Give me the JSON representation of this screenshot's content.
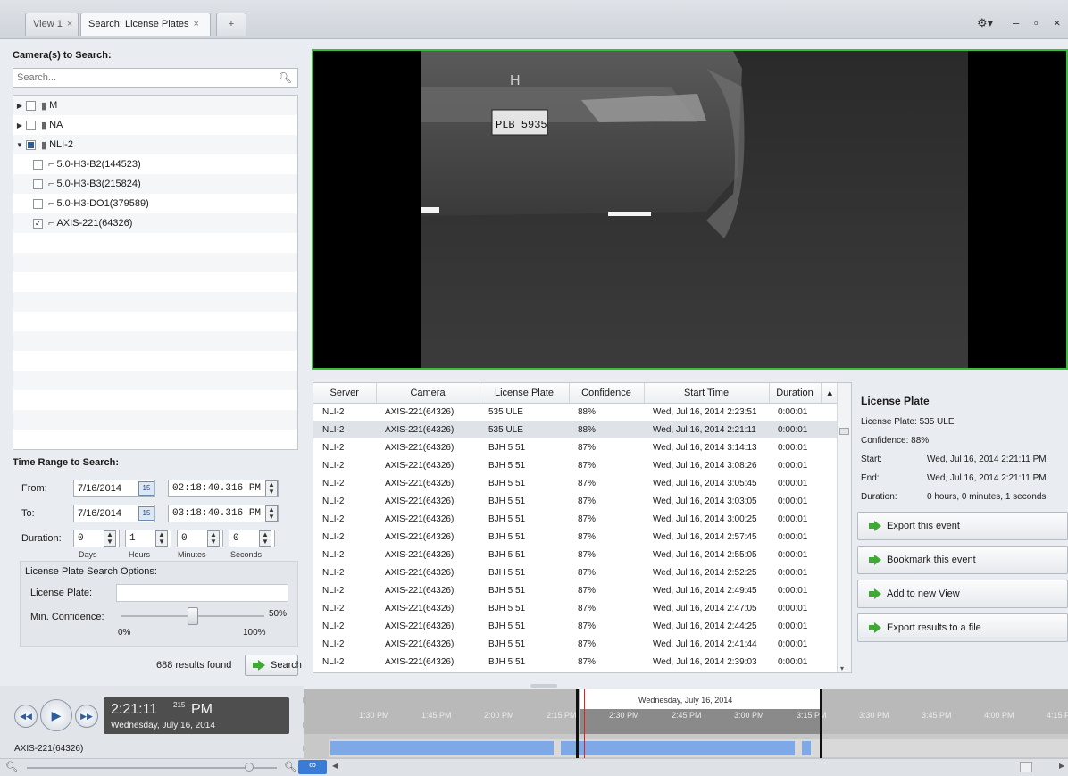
{
  "tabs": [
    {
      "label": "View 1",
      "close": "×",
      "active": false
    },
    {
      "label": "Search: License Plates",
      "close": "×",
      "active": true
    }
  ],
  "new_tab_label": "+",
  "window_controls": {
    "settings": "⚙▾",
    "minimize": "–",
    "restore": "▫",
    "close": "×"
  },
  "left": {
    "cameras_title": "Camera(s) to Search:",
    "search_placeholder": "Search...",
    "tree": [
      {
        "label": "M",
        "level": 0,
        "expanded": false,
        "state": "unchecked",
        "icon": "server-icon"
      },
      {
        "label": "NA",
        "level": 0,
        "expanded": false,
        "state": "unchecked",
        "icon": "server-icon"
      },
      {
        "label": "NLI-2",
        "level": 0,
        "expanded": true,
        "state": "partial",
        "icon": "server-icon"
      },
      {
        "label": "5.0-H3-B2(144523)",
        "level": 1,
        "state": "unchecked",
        "icon": "camera-icon"
      },
      {
        "label": "5.0-H3-B3(215824)",
        "level": 1,
        "state": "unchecked",
        "icon": "camera-icon"
      },
      {
        "label": "5.0-H3-DO1(379589)",
        "level": 1,
        "state": "unchecked",
        "icon": "camera-icon"
      },
      {
        "label": "AXIS-221(64326)",
        "level": 1,
        "state": "checked",
        "icon": "camera-icon"
      }
    ],
    "time_title": "Time Range to Search:",
    "from_label": "From:",
    "from_date": "7/16/2014",
    "from_time": "02:18:40.316 PM",
    "to_label": "To:",
    "to_date": "7/16/2014",
    "to_time": "03:18:40.316 PM",
    "duration_label": "Duration:",
    "duration": {
      "days": "0",
      "hours": "1",
      "minutes": "0",
      "seconds": "0"
    },
    "duration_units": {
      "days": "Days",
      "hours": "Hours",
      "minutes": "Minutes",
      "seconds": "Seconds"
    },
    "calendar_glyph": "15",
    "lp_options_title": "License Plate Search Options:",
    "license_plate_label": "License Plate:",
    "license_plate_value": "",
    "min_conf_label": "Min. Confidence:",
    "min_conf_value": "50%",
    "min_conf_fraction": 0.5,
    "min_conf_min": "0%",
    "min_conf_max": "100%",
    "results_found": "688 results found",
    "search_button": "Search"
  },
  "video": {
    "plate_text": "PLB 5935"
  },
  "table": {
    "columns": [
      "Server",
      "Camera",
      "License Plate",
      "Confidence",
      "Start Time",
      "Duration"
    ],
    "rows": [
      [
        "NLI-2",
        "AXIS-221(64326)",
        "535 ULE",
        "88%",
        "Wed, Jul 16, 2014 2:23:51",
        "0:00:01"
      ],
      [
        "NLI-2",
        "AXIS-221(64326)",
        "535 ULE",
        "88%",
        "Wed, Jul 16, 2014 2:21:11",
        "0:00:01"
      ],
      [
        "NLI-2",
        "AXIS-221(64326)",
        "BJH 5 51",
        "87%",
        "Wed, Jul 16, 2014 3:14:13",
        "0:00:01"
      ],
      [
        "NLI-2",
        "AXIS-221(64326)",
        "BJH 5 51",
        "87%",
        "Wed, Jul 16, 2014 3:08:26",
        "0:00:01"
      ],
      [
        "NLI-2",
        "AXIS-221(64326)",
        "BJH 5 51",
        "87%",
        "Wed, Jul 16, 2014 3:05:45",
        "0:00:01"
      ],
      [
        "NLI-2",
        "AXIS-221(64326)",
        "BJH 5 51",
        "87%",
        "Wed, Jul 16, 2014 3:03:05",
        "0:00:01"
      ],
      [
        "NLI-2",
        "AXIS-221(64326)",
        "BJH 5 51",
        "87%",
        "Wed, Jul 16, 2014 3:00:25",
        "0:00:01"
      ],
      [
        "NLI-2",
        "AXIS-221(64326)",
        "BJH 5 51",
        "87%",
        "Wed, Jul 16, 2014 2:57:45",
        "0:00:01"
      ],
      [
        "NLI-2",
        "AXIS-221(64326)",
        "BJH 5 51",
        "87%",
        "Wed, Jul 16, 2014 2:55:05",
        "0:00:01"
      ],
      [
        "NLI-2",
        "AXIS-221(64326)",
        "BJH 5 51",
        "87%",
        "Wed, Jul 16, 2014 2:52:25",
        "0:00:01"
      ],
      [
        "NLI-2",
        "AXIS-221(64326)",
        "BJH 5 51",
        "87%",
        "Wed, Jul 16, 2014 2:49:45",
        "0:00:01"
      ],
      [
        "NLI-2",
        "AXIS-221(64326)",
        "BJH 5 51",
        "87%",
        "Wed, Jul 16, 2014 2:47:05",
        "0:00:01"
      ],
      [
        "NLI-2",
        "AXIS-221(64326)",
        "BJH 5 51",
        "87%",
        "Wed, Jul 16, 2014 2:44:25",
        "0:00:01"
      ],
      [
        "NLI-2",
        "AXIS-221(64326)",
        "BJH 5 51",
        "87%",
        "Wed, Jul 16, 2014 2:41:44",
        "0:00:01"
      ],
      [
        "NLI-2",
        "AXIS-221(64326)",
        "BJH 5 51",
        "87%",
        "Wed, Jul 16, 2014 2:39:03",
        "0:00:01"
      ]
    ],
    "selected_row": 1
  },
  "details": {
    "title": "License Plate",
    "plate_line": "License Plate: 535 ULE",
    "confidence_line": "Confidence:  88%",
    "start_label": "Start:",
    "start_value": "Wed, Jul 16, 2014 2:21:11 PM",
    "end_label": "End:",
    "end_value": "Wed, Jul 16, 2014 2:21:11 PM",
    "duration_label": "Duration:",
    "duration_value": "0 hours, 0 minutes, 1 seconds",
    "actions": [
      "Export this event",
      "Bookmark this event",
      "Add to new View",
      "Export results to a file"
    ]
  },
  "playback": {
    "time": "2:21:11",
    "ms": "215",
    "ampm": "PM",
    "date": "Wednesday, July 16, 2014",
    "camera": "AXIS-221(64326)",
    "timeline_date": "Wednesday, July 16, 2014",
    "ticks": [
      "1:30 PM",
      "1:45 PM",
      "2:00 PM",
      "2:15 PM",
      "2:30 PM",
      "2:45 PM",
      "3:00 PM",
      "3:15 PM",
      "3:30 PM",
      "3:45 PM",
      "4:00 PM",
      "4:15 PM"
    ],
    "link_label": "∞"
  },
  "colors": {
    "accent_green": "#3faa33",
    "video_border": "#3bbd3b",
    "timeline_track": "#7fa8e6",
    "playhead": "#e02020"
  }
}
